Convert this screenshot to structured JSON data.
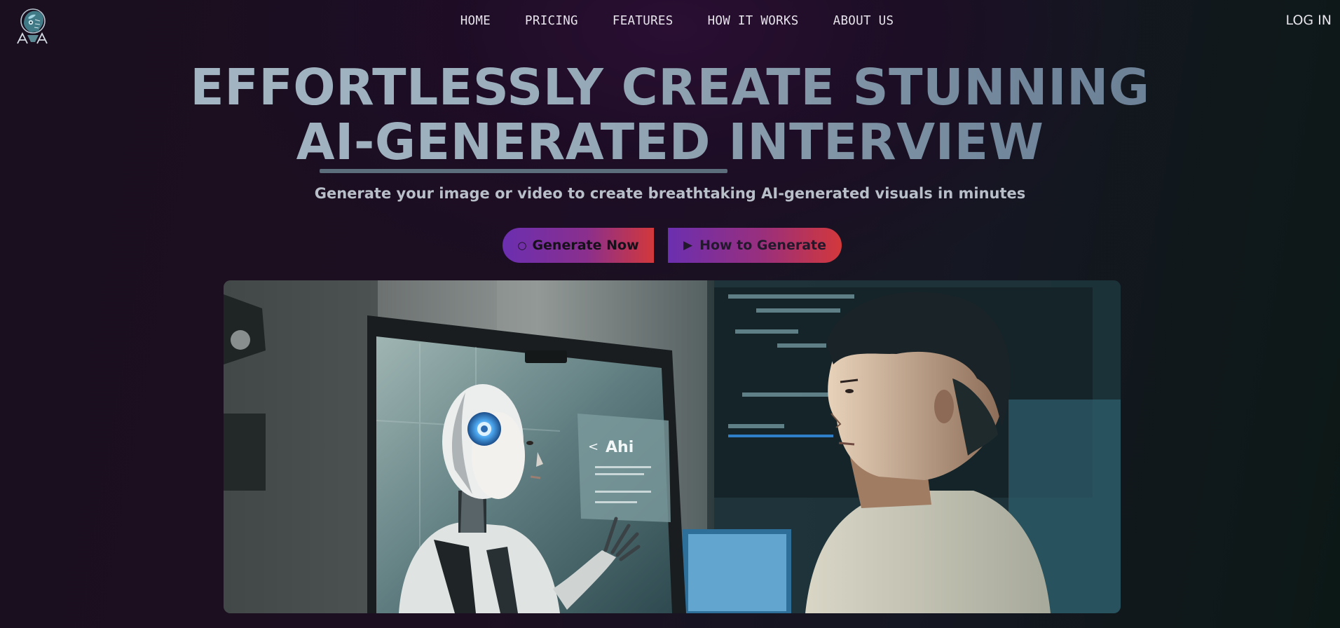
{
  "header": {
    "logo_icon": "robot-head-logo-icon",
    "nav": [
      {
        "label": "HOME"
      },
      {
        "label": "PRICING"
      },
      {
        "label": "FEATURES"
      },
      {
        "label": "HOW IT WORKS"
      },
      {
        "label": "ABOUT US"
      }
    ],
    "login_label": "LOG IN"
  },
  "hero": {
    "title_line_1": "EFFORTLESSLY CREATE STUNNING",
    "title_line_2": "AI-GENERATED INTERVIEW",
    "subtitle": "Generate your image or video to create breathtaking AI-generated visuals in minutes",
    "primary_button": {
      "icon": "circle-icon",
      "glyph": "○",
      "label": "Generate Now"
    },
    "secondary_button": {
      "icon": "play-icon",
      "glyph": "▶",
      "label": "How to Generate"
    },
    "image": {
      "alt": "robot-and-man-interview-image",
      "screen_text": "Ahi"
    }
  },
  "colors": {
    "button_gradient_start": "#6b2fb0",
    "button_gradient_end": "#d2383b",
    "title_gradient_start": "#a9bac6",
    "title_gradient_end": "#657a8e",
    "background": "#1a0f1e"
  }
}
